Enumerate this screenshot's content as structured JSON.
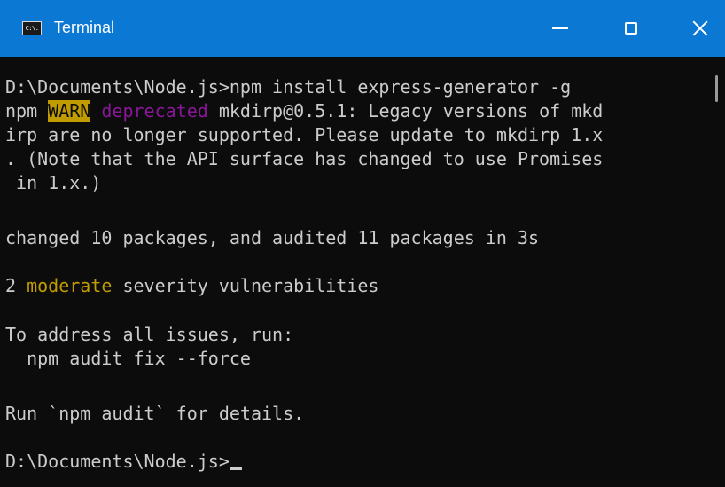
{
  "window": {
    "title": "Terminal",
    "icon": "cmd-icon",
    "icon_glyph": "C:\\.",
    "controls": {
      "minimize": "minimize-icon",
      "maximize": "maximize-icon",
      "close": "close-icon"
    },
    "colors": {
      "titlebar": "#0b78d4",
      "console_bg": "#0c0c0c",
      "text": "#cccccc",
      "warn_bg": "#c19c00",
      "deprecated": "#881798",
      "moderate": "#c19c00"
    }
  },
  "console": {
    "lines": [
      {
        "text": "D:\\Documents\\Node.js>npm install express-generator -g"
      },
      {
        "prefix": "npm ",
        "warn": "WARN",
        "space": " ",
        "deprecated": "deprecated",
        "rest": " mkdirp@0.5.1: Legacy versions of mkd"
      },
      {
        "text": "irp are no longer supported. Please update to mkdirp 1.x"
      },
      {
        "text": ". (Note that the API surface has changed to use Promises"
      },
      {
        "text": " in 1.x.)"
      },
      {
        "text": ""
      },
      {
        "text": "changed 10 packages, and audited 11 packages in 3s"
      },
      {
        "text": ""
      },
      {
        "prefix": "2 ",
        "moderate": "moderate",
        "rest": " severity vulnerabilities"
      },
      {
        "text": ""
      },
      {
        "text": "To address all issues, run:"
      },
      {
        "text": "  npm audit fix --force"
      },
      {
        "text": ""
      },
      {
        "text": "Run `npm audit` for details."
      },
      {
        "text": ""
      },
      {
        "text": "D:\\Documents\\Node.js>"
      }
    ]
  }
}
